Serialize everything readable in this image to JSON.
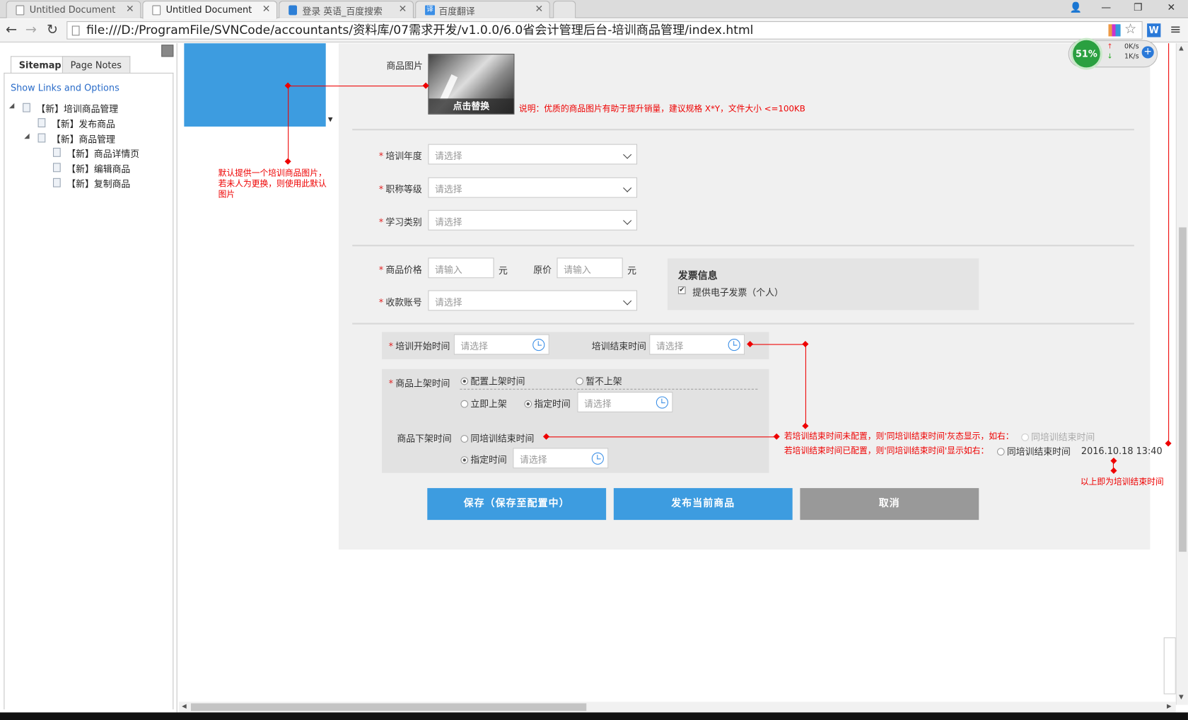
{
  "browser": {
    "tabs": [
      {
        "title": "Untitled Document",
        "active": false,
        "icon": "page-icon"
      },
      {
        "title": "Untitled Document",
        "active": true,
        "icon": "page-icon"
      },
      {
        "title": "登录 英语_百度搜索",
        "active": false,
        "icon": "baidu-paw-icon"
      },
      {
        "title": "百度翻译",
        "active": false,
        "icon": "fanyi-icon"
      }
    ],
    "fanyi_glyph": "译",
    "url": "file:///D:/ProgramFile/SVNCode/accountants/资料库/07需求开发/v1.0.0/6.0省会计管理后台-培训商品管理/index.html",
    "speed_widget": {
      "percent": "51%",
      "up": "0K/s",
      "down": "1K/s"
    }
  },
  "sidebar": {
    "tabs": [
      "Sitemap",
      "Page Notes"
    ],
    "link": "Show Links and Options",
    "tree": [
      {
        "label": "【新】培训商品管理",
        "level": 0,
        "expanded": true
      },
      {
        "label": "【新】发布商品",
        "level": 1
      },
      {
        "label": "【新】商品管理",
        "level": 1,
        "expanded": true
      },
      {
        "label": "【新】商品详情页",
        "level": 2
      },
      {
        "label": "【新】编辑商品",
        "level": 2
      },
      {
        "label": "【新】复制商品",
        "level": 2
      }
    ]
  },
  "form": {
    "image_label": "商品图片",
    "image_replace": "点击替换",
    "image_note": "说明：优质的商品图片有助于提升销量，建议规格 X*Y，文件大小 <=100KB",
    "left_note": "默认提供一个培训商品图片，若未人为更换，则使用此默认图片",
    "year_label": "培训年度",
    "title_label": "职称等级",
    "category_label": "学习类别",
    "select_placeholder": "请选择",
    "input_placeholder": "请输入",
    "price_label": "商品价格",
    "original_label": "原价",
    "unit": "元",
    "account_label": "收款账号",
    "invoice_title": "发票信息",
    "invoice_option": "提供电子发票（个人）",
    "train_start_label": "培训开始时间",
    "train_end_label": "培训结束时间",
    "shelf_on_label": "商品上架时间",
    "shelf_on_opt1": "配置上架时间",
    "shelf_on_opt2": "暂不上架",
    "shelf_on_opt3": "立即上架",
    "shelf_on_opt4": "指定时间",
    "shelf_off_label": "商品下架时间",
    "shelf_off_opt1": "同培训结束时间",
    "shelf_off_opt2": "指定时间",
    "note_unset": "若培训结束时间未配置，则'同培训结束时间'灰态显示，如右：",
    "note_unset_sample": "同培训结束时间",
    "note_set": "若培训结束时间已配置，则'同培训结束时间'显示如右：",
    "note_set_sample": "同培训结束时间",
    "note_set_time": "2016.10.18 13:40",
    "note_end": "以上即为培训结束时间",
    "buttons": {
      "save": "保存（保存至配置中）",
      "publish": "发布当前商品",
      "cancel": "取消"
    }
  },
  "colors": {
    "accent": "#3d9ce0",
    "danger": "#e00000",
    "cancel": "#999999"
  }
}
